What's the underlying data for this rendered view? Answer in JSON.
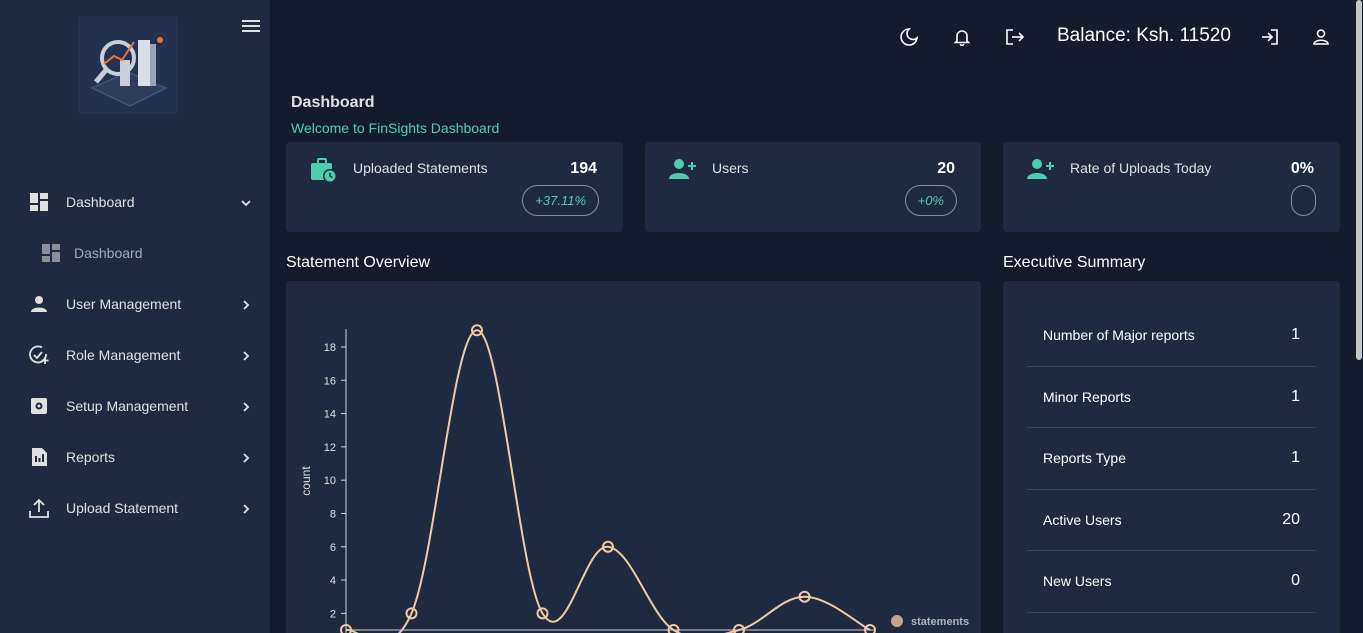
{
  "app": {
    "name": "FinSights"
  },
  "sidebar": {
    "items": [
      {
        "label": "Dashboard",
        "icon": "dashboard-icon",
        "chevron": "down"
      },
      {
        "label": "Dashboard",
        "icon": "dashboard-icon",
        "sub": true
      },
      {
        "label": "User Management",
        "icon": "person-icon",
        "chevron": "right"
      },
      {
        "label": "Role Management",
        "icon": "verified-add-icon",
        "chevron": "right"
      },
      {
        "label": "Setup Management",
        "icon": "settings-icon",
        "chevron": "right"
      },
      {
        "label": "Reports",
        "icon": "report-icon",
        "chevron": "right"
      },
      {
        "label": "Upload Statement",
        "icon": "upload-icon",
        "chevron": "right"
      }
    ]
  },
  "topbar": {
    "balance": "Balance: Ksh. 11520"
  },
  "header": {
    "title": "Dashboard",
    "subtitle": "Welcome to FinSights Dashboard"
  },
  "stats": [
    {
      "label": "Uploaded Statements",
      "value": "194",
      "change": "+37.11%",
      "icon": "briefcase-clock-icon"
    },
    {
      "label": "Users",
      "value": "20",
      "change": "+0%",
      "icon": "person-add-icon"
    },
    {
      "label": "Rate of Uploads Today",
      "value": "0%",
      "change": "",
      "icon": "person-add-icon"
    }
  ],
  "sections": {
    "overview": "Statement Overview",
    "summary": "Executive Summary"
  },
  "summary": [
    {
      "label": "Number of Major reports",
      "value": "1"
    },
    {
      "label": "Minor Reports",
      "value": "1"
    },
    {
      "label": "Reports Type",
      "value": "1"
    },
    {
      "label": "Active Users",
      "value": "20"
    },
    {
      "label": "New Users",
      "value": "0"
    }
  ],
  "colors": {
    "accent": "#4cceac",
    "line": "#f1c9a3",
    "panel": "#1f2a40",
    "background": "#141b2d"
  },
  "chart_data": {
    "type": "line",
    "x": [
      0,
      1,
      2,
      3,
      4,
      5,
      6,
      7,
      8
    ],
    "series": [
      {
        "name": "statements",
        "values": [
          1,
          2,
          19,
          2,
          6,
          1,
          1,
          3,
          1
        ]
      }
    ],
    "xlabel": "",
    "ylabel": "count",
    "yticks": [
      "2",
      "4",
      "6",
      "8",
      "10",
      "12",
      "14",
      "16",
      "18"
    ],
    "ylim": [
      1,
      19
    ],
    "legend": "bottom-right",
    "grid": false
  }
}
